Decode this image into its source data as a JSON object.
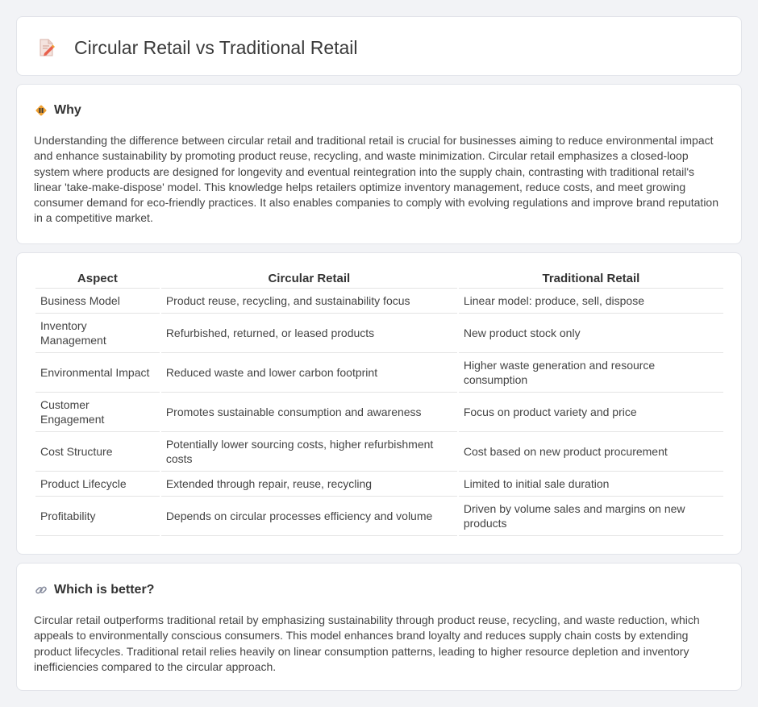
{
  "header": {
    "title": "Circular Retail vs Traditional Retail",
    "icon": "document-pencil-icon"
  },
  "why": {
    "heading": "Why",
    "icon": "warning-sign-icon",
    "text": "Understanding the difference between circular retail and traditional retail is crucial for businesses aiming to reduce environmental impact and enhance sustainability by promoting product reuse, recycling, and waste minimization. Circular retail emphasizes a closed-loop system where products are designed for longevity and eventual reintegration into the supply chain, contrasting with traditional retail's linear 'take-make-dispose' model. This knowledge helps retailers optimize inventory management, reduce costs, and meet growing consumer demand for eco-friendly practices. It also enables companies to comply with evolving regulations and improve brand reputation in a competitive market."
  },
  "table": {
    "headers": [
      "Aspect",
      "Circular Retail",
      "Traditional Retail"
    ],
    "rows": [
      [
        "Business Model",
        "Product reuse, recycling, and sustainability focus",
        "Linear model: produce, sell, dispose"
      ],
      [
        "Inventory Management",
        "Refurbished, returned, or leased products",
        "New product stock only"
      ],
      [
        "Environmental Impact",
        "Reduced waste and lower carbon footprint",
        "Higher waste generation and resource consumption"
      ],
      [
        "Customer Engagement",
        "Promotes sustainable consumption and awareness",
        "Focus on product variety and price"
      ],
      [
        "Cost Structure",
        "Potentially lower sourcing costs, higher refurbishment costs",
        "Cost based on new product procurement"
      ],
      [
        "Product Lifecycle",
        "Extended through repair, reuse, recycling",
        "Limited to initial sale duration"
      ],
      [
        "Profitability",
        "Depends on circular processes efficiency and volume",
        "Driven by volume sales and margins on new products"
      ]
    ]
  },
  "better": {
    "heading": "Which is better?",
    "icon": "link-icon",
    "text": "Circular retail outperforms traditional retail by emphasizing sustainability through product reuse, recycling, and waste reduction, which appeals to environmentally conscious consumers. This model enhances brand loyalty and reduces supply chain costs by extending product lifecycles. Traditional retail relies heavily on linear consumption patterns, leading to higher resource depletion and inventory inefficiencies compared to the circular approach."
  },
  "colors": {
    "background": "#f2f3f6",
    "card": "#ffffff",
    "accent": "#f0a030",
    "icon_red": "#e8604c"
  }
}
